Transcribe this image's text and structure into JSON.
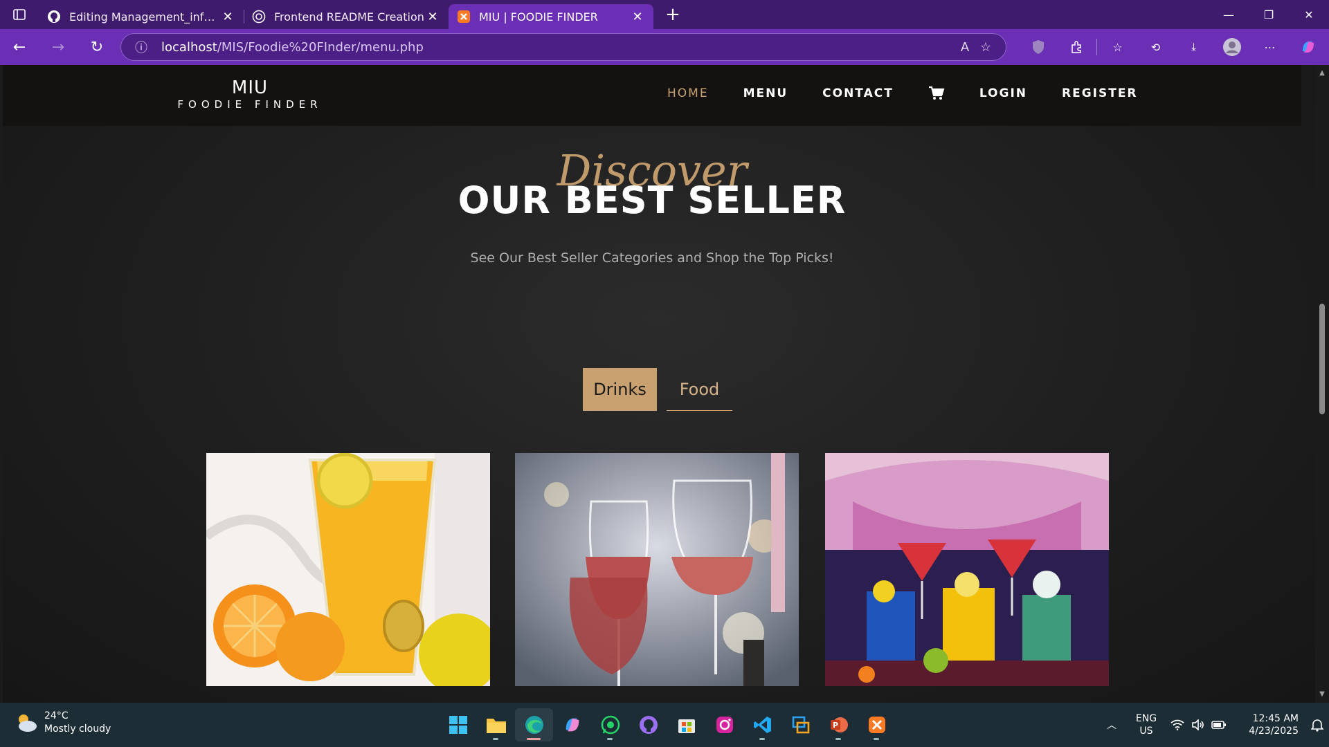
{
  "browser": {
    "tabs": [
      {
        "title": "Editing Management_information",
        "icon": "github-icon",
        "active": false
      },
      {
        "title": "Frontend README Creation",
        "icon": "chatgpt-icon",
        "active": false
      },
      {
        "title": "MIU | FOODIE FINDER",
        "icon": "xampp-icon",
        "active": true
      }
    ],
    "url_host": "localhost",
    "url_path": "/MIS/Foodie%20FInder/menu.php"
  },
  "site": {
    "logo_line1": "MIU",
    "logo_line2": "FOODIE FINDER",
    "nav": [
      "HOME",
      "MENU",
      "CONTACT",
      "LOGIN",
      "REGISTER"
    ],
    "active_nav": "HOME",
    "accent_color": "#c9a070"
  },
  "section": {
    "script_heading": "Discover",
    "title": "OUR BEST SELLER",
    "subtitle": "See Our Best Seller Categories and Shop the Top Picks!",
    "filters": [
      "Drinks",
      "Food"
    ],
    "active_filter": "Drinks"
  },
  "cards": [
    {
      "image": "orange-juice-image"
    },
    {
      "image": "rose-wine-glasses-image"
    },
    {
      "image": "colorful-cocktails-image"
    }
  ],
  "taskbar": {
    "temperature": "24°C",
    "condition": "Mostly cloudy",
    "lang_line1": "ENG",
    "lang_line2": "US",
    "time": "12:45 AM",
    "date": "4/23/2025"
  }
}
